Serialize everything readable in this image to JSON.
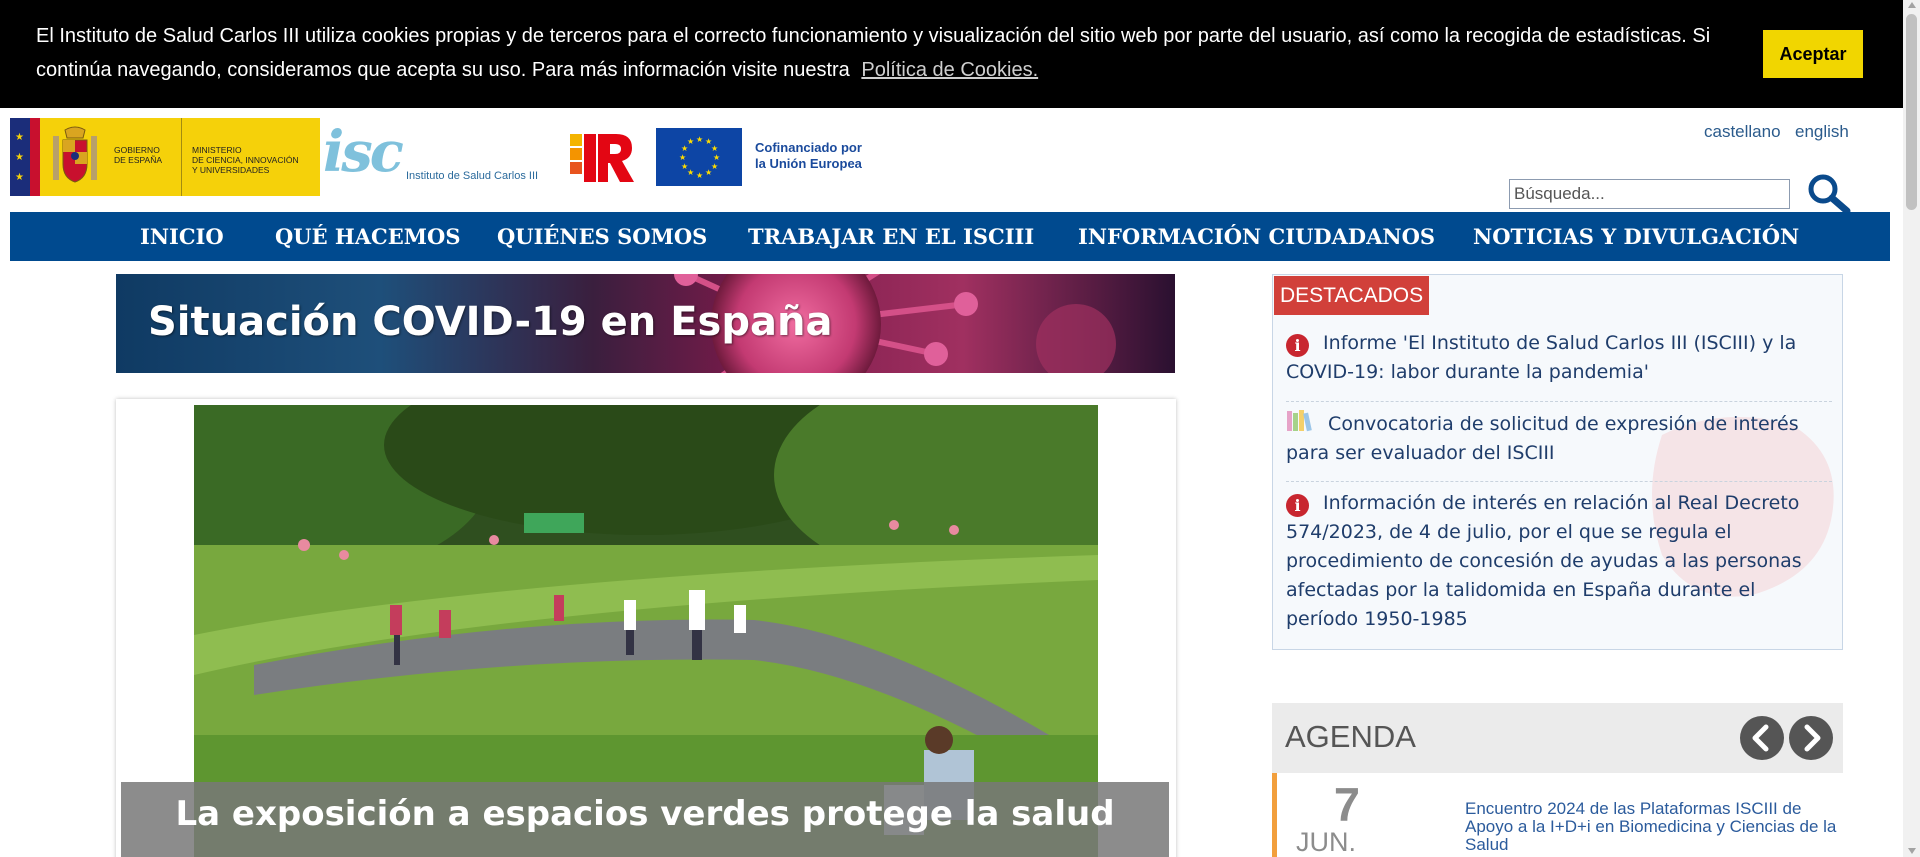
{
  "cookie_bar": {
    "text": "El Instituto de Salud Carlos III utiliza cookies propias y de terceros para el correcto funcionamiento y visualización del sitio web por parte del usuario, así como la recogida de estadísticas. Si continúa navegando, consideramos que acepta su uso. Para más información visite nuestra",
    "link_label": "Política de Cookies.",
    "accept_label": "Aceptar"
  },
  "header": {
    "gobierno_line1": "GOBIERNO",
    "gobierno_line2": "DE ESPAÑA",
    "ministerio_line1": "MINISTERIO",
    "ministerio_line2": "DE CIENCIA, INNOVACIÓN",
    "ministerio_line3": "Y UNIVERSIDADES",
    "isciii_mark": "isc",
    "isciii_name": "Instituto de Salud Carlos III",
    "eu_line1": "Cofinanciado por",
    "eu_line2": "la Unión Europea",
    "lang_es": "castellano",
    "lang_en": "english",
    "search_placeholder": "Búsqueda..."
  },
  "nav": {
    "items": [
      "INICIO",
      "QUÉ HACEMOS",
      "QUIÉNES SOMOS",
      "TRABAJAR EN EL ISCIII",
      "INFORMACIÓN CIUDADANOS",
      "NOTICIAS Y DIVULGACIÓN"
    ]
  },
  "covid_banner": {
    "title": "Situación COVID-19 en España"
  },
  "carousel": {
    "caption": "La exposición a espacios verdes protege la salud"
  },
  "destacados": {
    "title": "DESTACADOS",
    "items": [
      {
        "icon": "info-icon",
        "text": "Informe 'El Instituto de Salud Carlos III (ISCIII) y la COVID-19: labor durante la pandemia'"
      },
      {
        "icon": "books-icon",
        "text": "Convocatoria de solicitud de expresión de interés para ser evaluador del ISCIII"
      },
      {
        "icon": "info-icon",
        "text": "Información de interés en relación al Real Decreto 574/2023, de 4 de julio, por el que se regula el procedimiento de concesión de ayudas a las personas afectadas por la talidomida en España durante el período 1950-1985"
      }
    ]
  },
  "agenda": {
    "title": "AGENDA",
    "event": {
      "day": "7",
      "month": "JUN.",
      "text": "Encuentro 2024 de las Plataformas ISCIII de Apoyo a la I+D+i en Biomedicina y Ciencias de la Salud"
    }
  },
  "colors": {
    "nav_blue": "#004a8f",
    "accept_yellow": "#f1d600",
    "destacados_red": "#d1403a",
    "agenda_orange": "#f29f3c"
  }
}
